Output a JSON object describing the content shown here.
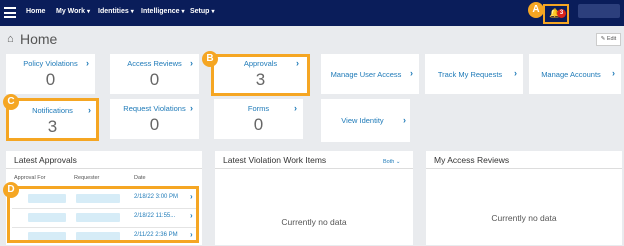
{
  "nav": {
    "items": [
      {
        "label": "Home",
        "caret": ""
      },
      {
        "label": "My Work",
        "caret": "▾"
      },
      {
        "label": "Identities",
        "caret": "▾"
      },
      {
        "label": "Intelligence",
        "caret": "▾"
      },
      {
        "label": "Setup",
        "caret": "▾"
      }
    ],
    "notification_count": "3"
  },
  "callouts": {
    "a": "A",
    "b": "B",
    "c": "C",
    "d": "D"
  },
  "page": {
    "title": "Home",
    "edit_label": "Edit"
  },
  "tiles": [
    {
      "label": "Policy Violations",
      "value": "0"
    },
    {
      "label": "Access Reviews",
      "value": "0"
    },
    {
      "label": "Approvals",
      "value": "3"
    },
    {
      "label": "Manage User Access"
    },
    {
      "label": "Track My Requests"
    },
    {
      "label": "Manage Accounts"
    },
    {
      "label": "Notifications",
      "value": "3"
    },
    {
      "label": "Request Violations",
      "value": "0"
    },
    {
      "label": "Forms",
      "value": "0"
    },
    {
      "label": "View Identity"
    }
  ],
  "latest_approvals": {
    "title": "Latest Approvals",
    "columns": [
      "Approval For",
      "Requester",
      "Date"
    ],
    "rows": [
      {
        "date": "2/18/22 3:00 PM"
      },
      {
        "date": "2/18/22 11:55..."
      },
      {
        "date": "2/11/22 2:36 PM"
      }
    ]
  },
  "violations": {
    "title": "Latest Violation Work Items",
    "filter": "Both",
    "empty": "Currently no data"
  },
  "reviews": {
    "title": "My Access Reviews",
    "empty": "Currently no data"
  },
  "colors": {
    "nav": "#0a1d5a",
    "accent": "#1e7ab8",
    "highlight": "#f5a623",
    "badge": "#d9251c"
  }
}
